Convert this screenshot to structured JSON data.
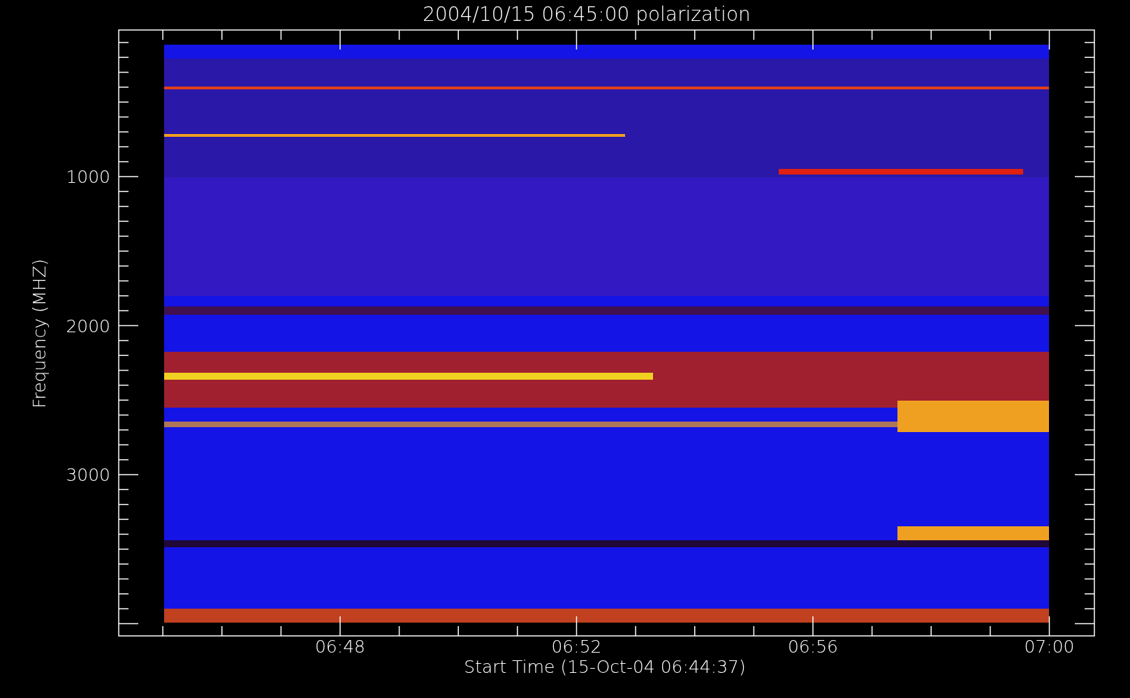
{
  "title": "2004/10/15 06:45:00 polarization",
  "y_axis": {
    "title": "Frequency (MHZ)",
    "tick_labels": [
      "1000",
      "2000",
      "3000"
    ]
  },
  "x_axis": {
    "title": "Start Time (15-Oct-04 06:44:37)",
    "tick_labels": [
      "06:48",
      "06:52",
      "06:56",
      "07:00"
    ]
  }
}
